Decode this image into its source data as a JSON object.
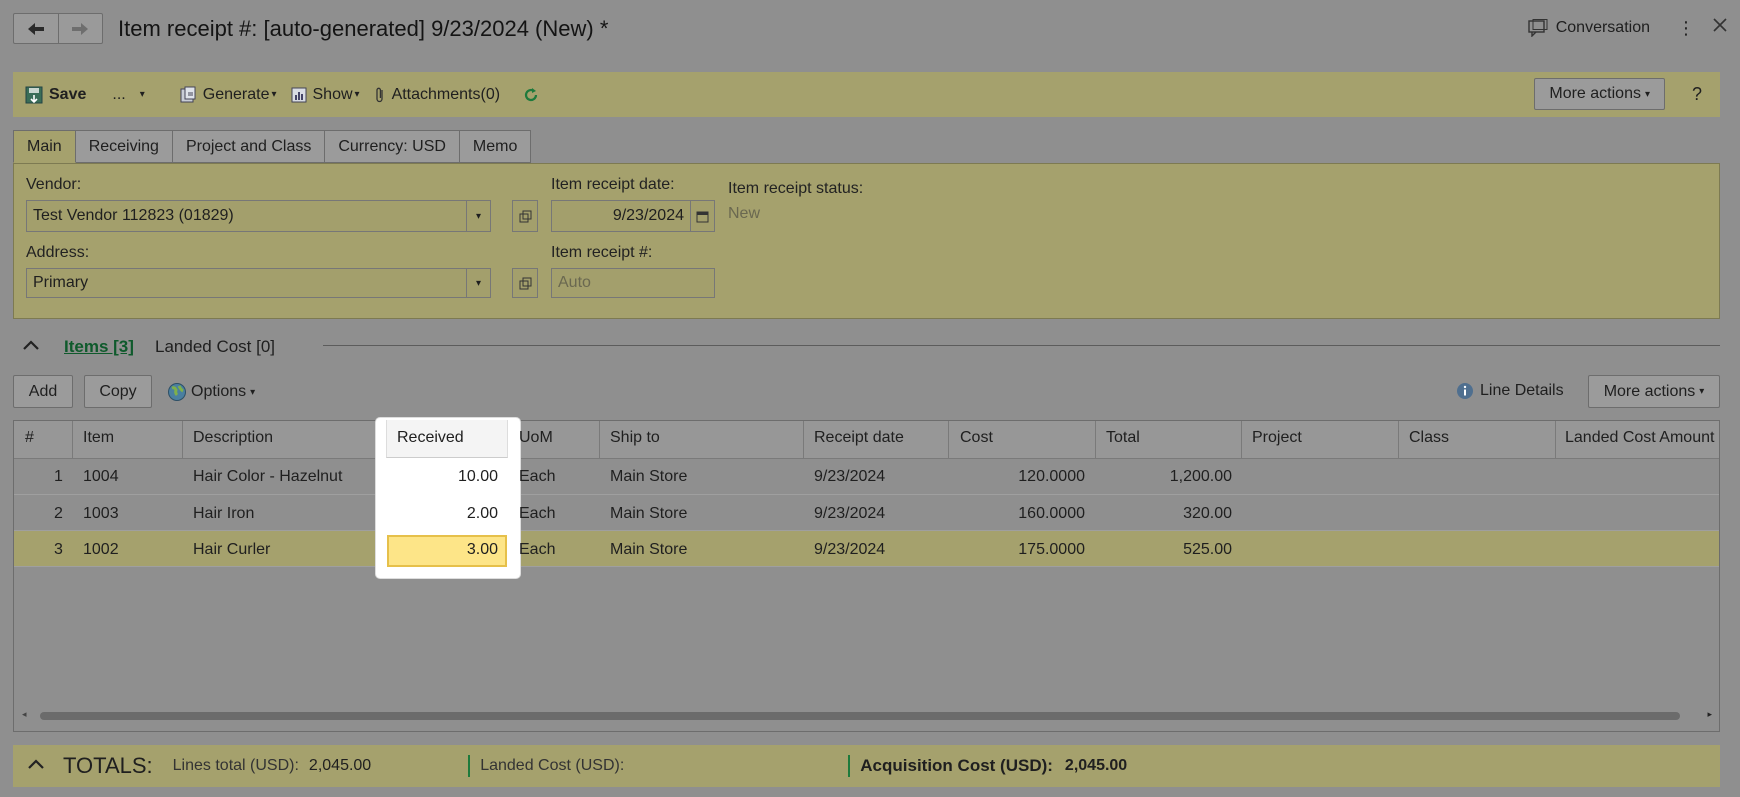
{
  "title": "Item receipt #: [auto-generated] 9/23/2024 (New) *",
  "top_right": {
    "conversation": "Conversation"
  },
  "toolbar": {
    "save": "Save",
    "more_dots": "...",
    "generate": "Generate",
    "show": "Show",
    "attachments": "Attachments(0)",
    "more_actions": "More actions",
    "help": "?"
  },
  "tabs": [
    "Main",
    "Receiving",
    "Project and Class",
    "Currency: USD",
    "Memo"
  ],
  "form": {
    "vendor_label": "Vendor:",
    "vendor_value": "Test Vendor 112823 (01829)",
    "address_label": "Address:",
    "address_value": "Primary",
    "receipt_date_label": "Item receipt date:",
    "receipt_date_value": "9/23/2024",
    "receipt_no_label": "Item receipt #:",
    "receipt_no_placeholder": "Auto",
    "status_label": "Item receipt status:",
    "status_value": "New"
  },
  "section": {
    "items_tab": "Items [3]",
    "landed_cost_tab": "Landed Cost [0]"
  },
  "grid_toolbar": {
    "add": "Add",
    "copy": "Copy",
    "options": "Options",
    "line_details": "Line Details",
    "more_actions": "More actions"
  },
  "grid": {
    "columns": [
      "#",
      "Item",
      "Description",
      "Received",
      "UoM",
      "Ship to",
      "Receipt date",
      "Cost",
      "Total",
      "Project",
      "Class",
      "Landed Cost Amount"
    ],
    "rows": [
      {
        "num": "1",
        "item": "1004",
        "description": "Hair Color - Hazelnut",
        "received": "10.00",
        "uom": "Each",
        "ship_to": "Main Store",
        "receipt_date": "9/23/2024",
        "cost": "120.0000",
        "total": "1,200.00",
        "project": "",
        "class": "",
        "landed": ""
      },
      {
        "num": "2",
        "item": "1003",
        "description": "Hair Iron",
        "received": "2.00",
        "uom": "Each",
        "ship_to": "Main Store",
        "receipt_date": "9/23/2024",
        "cost": "160.0000",
        "total": "320.00",
        "project": "",
        "class": "",
        "landed": ""
      },
      {
        "num": "3",
        "item": "1002",
        "description": "Hair Curler",
        "received": "3.00",
        "uom": "Each",
        "ship_to": "Main Store",
        "receipt_date": "9/23/2024",
        "cost": "175.0000",
        "total": "525.00",
        "project": "",
        "class": "",
        "landed": ""
      }
    ]
  },
  "totals": {
    "title": "TOTALS:",
    "lines_total_label": "Lines total (USD):",
    "lines_total_value": "2,045.00",
    "landed_cost_label": "Landed Cost (USD):",
    "acq_cost_label": "Acquisition Cost (USD):",
    "acq_cost_value": "2,045.00"
  },
  "colors": {
    "toolbar_bg": "#a5a16d",
    "accent_green": "#1e7a3c",
    "highlight_cell": "#fde588"
  }
}
